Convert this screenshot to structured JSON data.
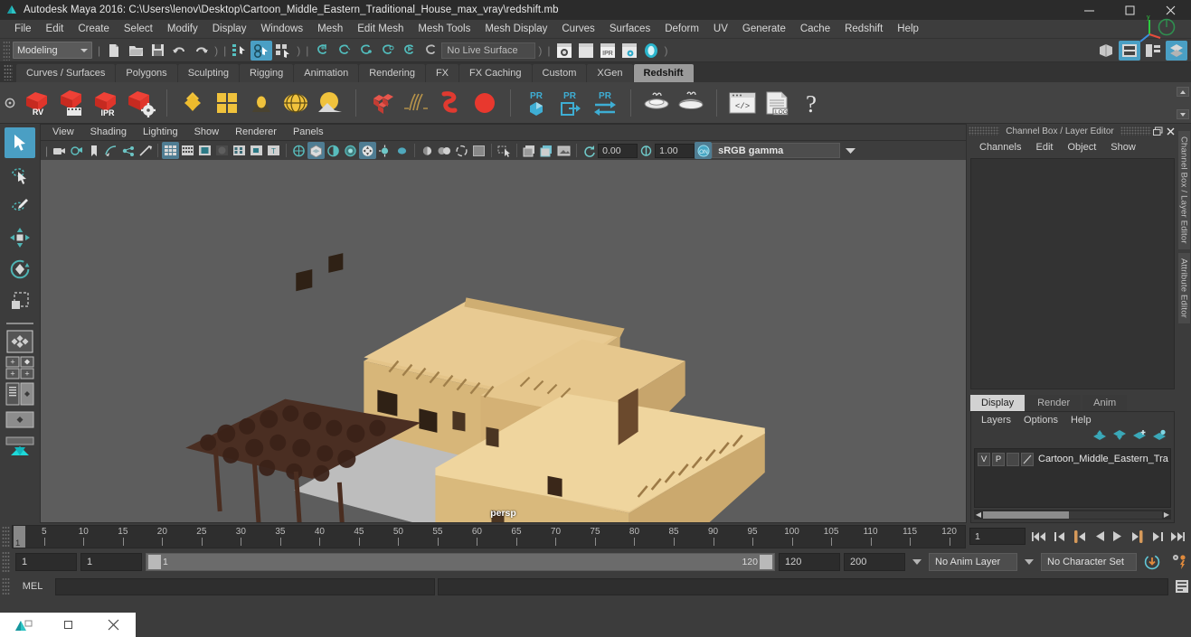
{
  "window": {
    "title": "Autodesk Maya 2016: C:\\Users\\lenov\\Desktop\\Cartoon_Middle_Eastern_Traditional_House_max_vray\\redshift.mb",
    "app_icon": "maya-icon",
    "minimize": "minimize-icon",
    "maximize": "maximize-icon",
    "close": "close-icon"
  },
  "menubar": {
    "items": [
      "File",
      "Edit",
      "Create",
      "Select",
      "Modify",
      "Display",
      "Windows",
      "Mesh",
      "Edit Mesh",
      "Mesh Tools",
      "Mesh Display",
      "Curves",
      "Surfaces",
      "Deform",
      "UV",
      "Generate",
      "Cache",
      "Redshift",
      "Help"
    ]
  },
  "statusbar": {
    "mode": "Modeling",
    "live_surface": "No Live Surface",
    "file_icons": [
      "new-scene-icon",
      "open-scene-icon",
      "save-scene-icon",
      "undo-icon",
      "redo-icon"
    ],
    "select_icons": [
      "select-by-hierarchy-icon",
      "select-by-object-icon",
      "select-by-component-icon"
    ],
    "snap_icons": [
      "snap-to-grid-icon",
      "snap-to-curve-icon",
      "snap-to-point-icon",
      "snap-to-projected-center-icon",
      "snap-to-view-plane-icon",
      "make-live-icon"
    ],
    "render_icons": [
      "render-current-frame-icon",
      "ipr-render-icon",
      "ipr-icon",
      "render-settings-icon",
      "hypershade-icon"
    ],
    "editor_icons": [
      "show-hide-modeling-toolkit-icon",
      "show-hide-attribute-editor-icon",
      "show-hide-tool-settings-icon",
      "show-hide-channel-box-icon"
    ]
  },
  "shelf": {
    "tabs": [
      "Curves / Surfaces",
      "Polygons",
      "Sculpting",
      "Rigging",
      "Animation",
      "Rendering",
      "FX",
      "FX Caching",
      "Custom",
      "XGen",
      "Redshift"
    ],
    "selected_tab": "Redshift",
    "buttons": [
      {
        "name": "redshift-render-view",
        "label": "RV"
      },
      {
        "name": "redshift-render-sequence",
        "label": ""
      },
      {
        "name": "redshift-ipr-render",
        "label": "IPR"
      },
      {
        "name": "redshift-render-settings",
        "label": ""
      },
      {
        "name": "redshift-create-light",
        "label": ""
      },
      {
        "name": "redshift-area-light",
        "label": ""
      },
      {
        "name": "redshift-ies-light",
        "label": ""
      },
      {
        "name": "redshift-dome-light",
        "label": ""
      },
      {
        "name": "redshift-physical-sun",
        "label": ""
      },
      {
        "name": "redshift-proxy-object",
        "label": ""
      },
      {
        "name": "redshift-hair-object",
        "label": ""
      },
      {
        "name": "redshift-volume-object",
        "label": ""
      },
      {
        "name": "redshift-sphere-object",
        "label": ""
      },
      {
        "name": "redshift-pr-material",
        "label": "PR"
      },
      {
        "name": "redshift-pr-export",
        "label": "PR"
      },
      {
        "name": "redshift-pr-transfer",
        "label": "PR"
      },
      {
        "name": "redshift-bake-set",
        "label": ""
      },
      {
        "name": "redshift-bake-all",
        "label": ""
      },
      {
        "name": "redshift-script-editor",
        "label": ""
      },
      {
        "name": "redshift-log-file",
        "label": ".LOG"
      },
      {
        "name": "redshift-help",
        "label": "?"
      }
    ]
  },
  "toolbox": {
    "tools": [
      {
        "name": "select-tool",
        "selected": true
      },
      {
        "name": "lasso-select-tool",
        "selected": false
      },
      {
        "name": "paint-select-tool",
        "selected": false
      },
      {
        "name": "move-tool",
        "selected": false
      },
      {
        "name": "rotate-tool",
        "selected": false
      },
      {
        "name": "scale-tool",
        "selected": false
      }
    ],
    "layouts": [
      {
        "name": "single-perspective-view-layout",
        "selected": true
      },
      {
        "name": "four-view-layout",
        "selected": false
      },
      {
        "name": "outliner-persp-layout",
        "selected": false
      },
      {
        "name": "persp-graph-layout",
        "selected": false
      },
      {
        "name": "hypershade-persp-layout",
        "selected": false
      }
    ]
  },
  "viewport": {
    "menus": [
      "View",
      "Shading",
      "Lighting",
      "Show",
      "Renderer",
      "Panels"
    ],
    "camera_label": "persp",
    "exposure": "0.00",
    "gamma": "1.00",
    "color_management": "sRGB gamma",
    "panel_icons": [
      "camera-attributes-icon",
      "bookmarks-icon",
      "image-plane-icon",
      "two-d-pan-zoom-icon",
      "grease-pencil-icon",
      "snapshot-icon"
    ],
    "display_icons": [
      "wireframe-icon",
      "smooth-shade-all-icon",
      "smooth-shade-selected-icon",
      "flat-shade-icon",
      "shaded-wireframe-icon",
      "textured-icon",
      "use-default-material-icon"
    ],
    "light_icons": [
      "lighting-off-icon",
      "all-lights-icon",
      "shadows-icon",
      "screen-space-ao-icon",
      "motion-blur-icon",
      "multisample-icon",
      "xray-icon",
      "xray-joints-icon",
      "xray-active-components-icon",
      "isolate-select-icon",
      "grid-icon",
      "film-gate-icon"
    ]
  },
  "channelbox": {
    "panel_title": "Channel Box / Layer Editor",
    "menus": [
      "Channels",
      "Edit",
      "Object",
      "Show"
    ],
    "undock_icon": "undock-icon",
    "close_icon": "close-panel-icon",
    "view_cube": "view-axis-gizmo"
  },
  "layereditor": {
    "tabs": [
      "Display",
      "Render",
      "Anim"
    ],
    "selected_tab": "Display",
    "menus": [
      "Layers",
      "Options",
      "Help"
    ],
    "action_icons": [
      "move-layer-up-icon",
      "move-layer-down-icon",
      "new-layer-icon",
      "new-layer-from-selected-icon"
    ],
    "layers": [
      {
        "visibility": "V",
        "playback": "P",
        "shading": "",
        "color_swatch": "",
        "name": "Cartoon_Middle_Eastern_Tra"
      }
    ]
  },
  "timeslider": {
    "ticks": [
      5,
      10,
      15,
      20,
      25,
      30,
      35,
      40,
      45,
      50,
      55,
      60,
      65,
      70,
      75,
      80,
      85,
      90,
      95,
      100,
      105,
      110,
      115,
      120
    ],
    "current_frame_marker": "1",
    "current_frame_field": "1",
    "playback_buttons": [
      "go-to-start-icon",
      "step-back-keyframe-icon",
      "step-back-frame-icon",
      "play-backwards-icon",
      "play-forwards-icon",
      "step-forward-frame-icon",
      "step-forward-keyframe-icon",
      "go-to-end-icon"
    ]
  },
  "rangeslider": {
    "anim_start": "1",
    "range_start": "1",
    "bar_start_label": "1",
    "bar_end_label": "120",
    "range_end": "120",
    "anim_end": "200",
    "anim_layer": "No Anim Layer",
    "character_set": "No Character Set",
    "auto_key_icon": "auto-keyframe-icon",
    "anim_prefs_icon": "animation-preferences-icon"
  },
  "commandline": {
    "language_label": "MEL",
    "input_value": "",
    "output_value": "",
    "script_editor_icon": "script-editor-icon"
  },
  "taskbar": {
    "items": [
      "maya-taskbar-icon",
      "restore-icon",
      "close-icon"
    ]
  },
  "colors": {
    "accent_blue": "#4a9fc4",
    "redshift_red": "#e03a30",
    "panel_bg": "#3c3c3c",
    "viewport_bg": "#5d5d5d",
    "building": "#dfbe7f",
    "ground": "#b4b4b4"
  }
}
